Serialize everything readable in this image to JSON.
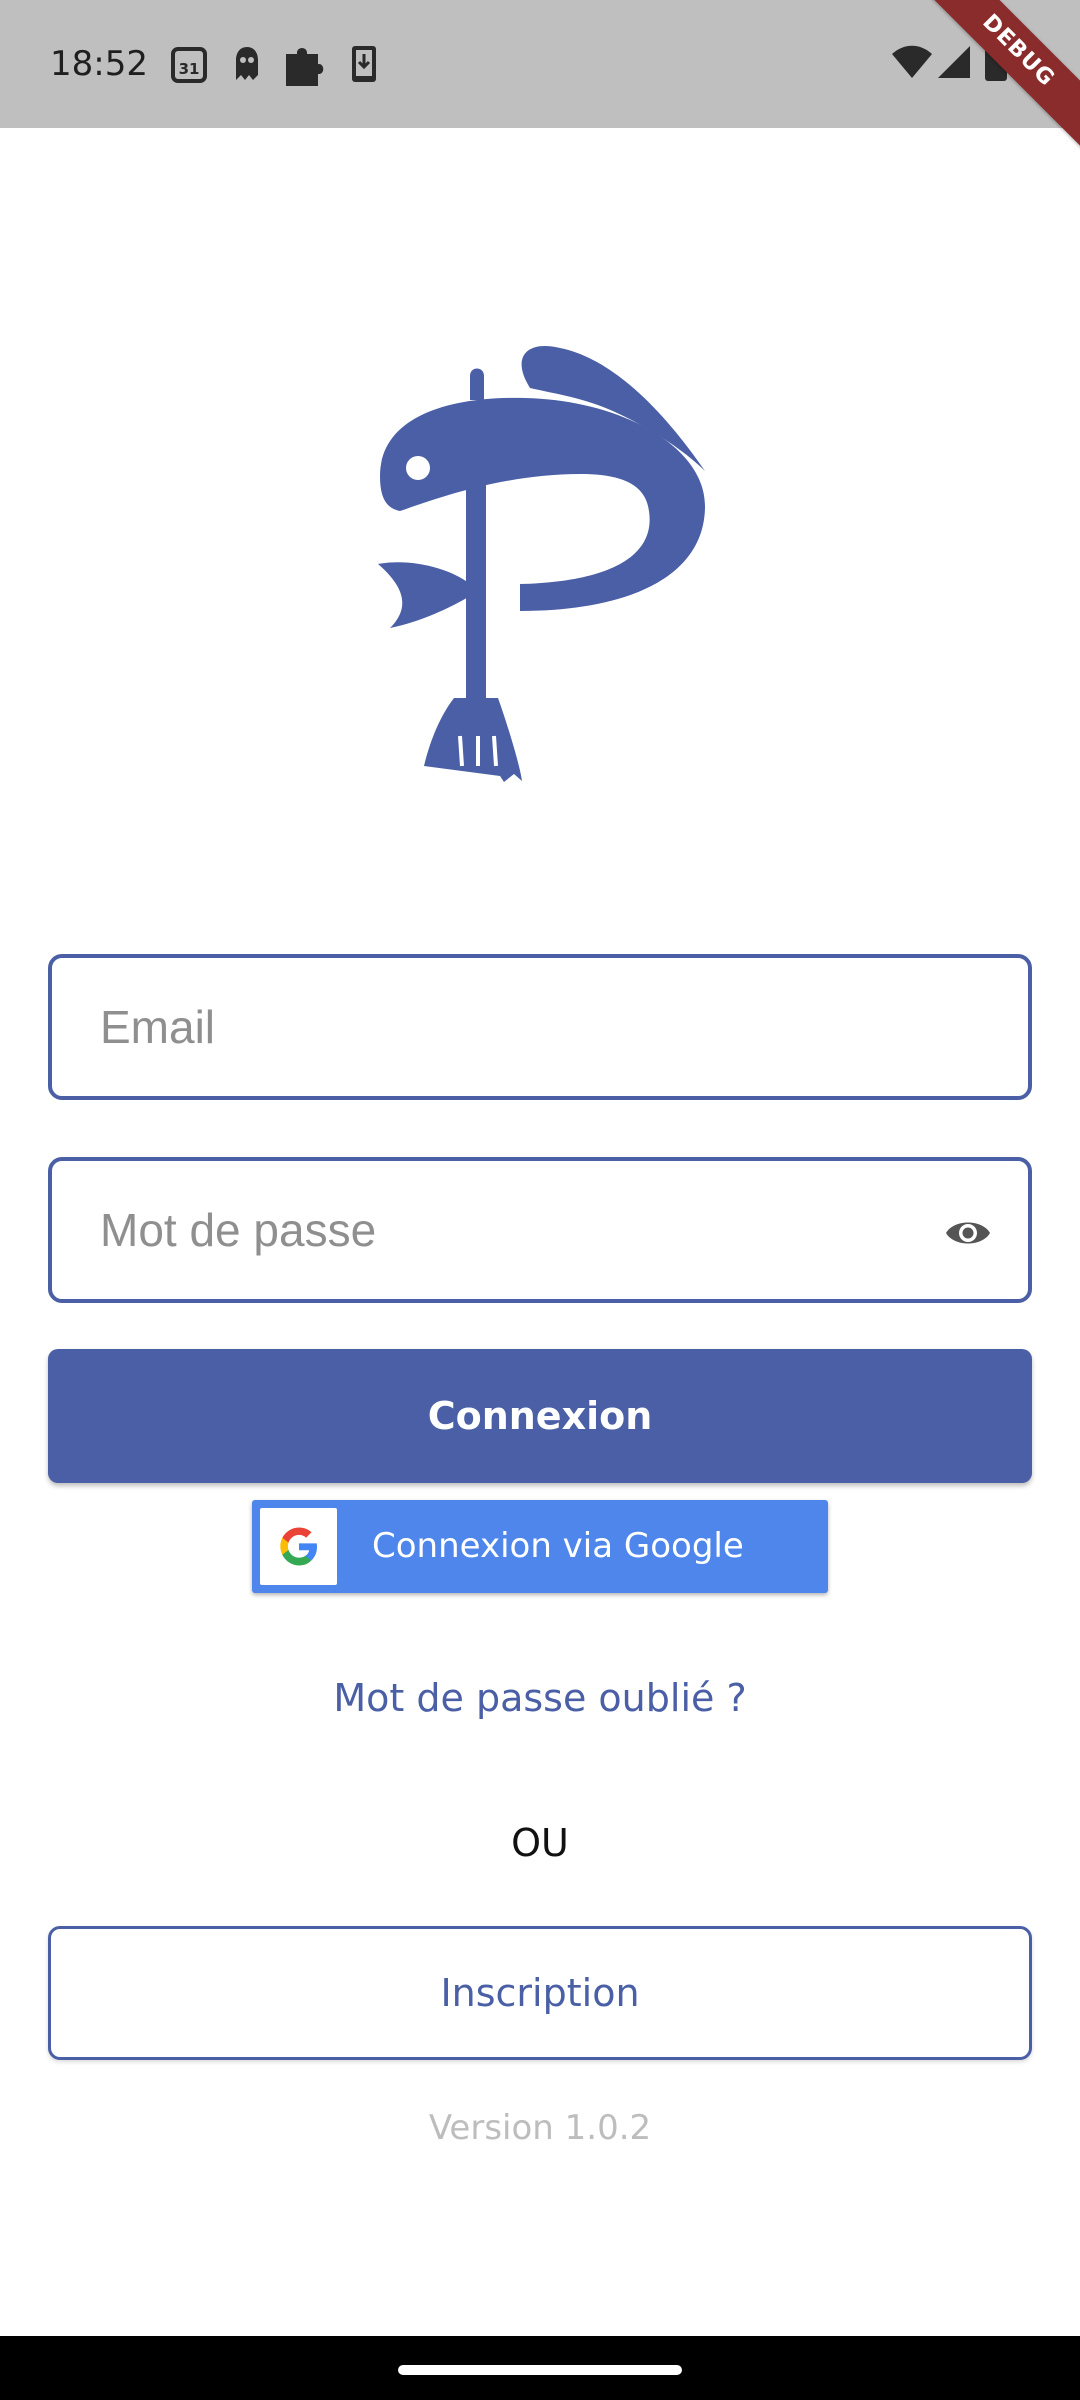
{
  "app": {
    "brand_color": "#4a5fa5",
    "logo_name": "fish-broom-logo"
  },
  "status_bar": {
    "time": "18:52",
    "left_icons": [
      "calendar-icon",
      "notification-icon",
      "puzzle-icon",
      "download-icon"
    ],
    "calendar_day": "31",
    "right_icons": [
      "wifi-icon",
      "signal-icon",
      "battery-icon"
    ],
    "debug_banner": "DEBUG"
  },
  "form": {
    "email_placeholder": "Email",
    "email_value": "",
    "password_placeholder": "Mot de passe",
    "password_value": "",
    "login_label": "Connexion",
    "google_label": "Connexion via Google",
    "forgot_label": "Mot de passe oublié ?",
    "or_label": "OU",
    "signup_label": "Inscription",
    "version_label": "Version 1.0.2"
  }
}
